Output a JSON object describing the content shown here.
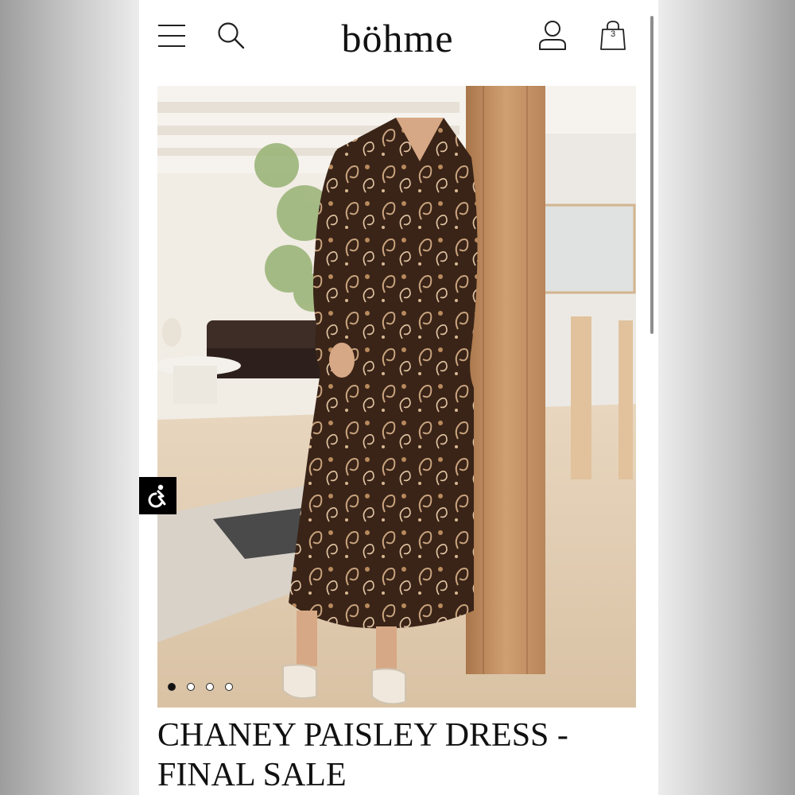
{
  "header": {
    "logo": "böhme",
    "bag_count": "3",
    "icons": [
      "hamburger-menu-icon",
      "search-icon",
      "account-icon",
      "shopping-bag-icon"
    ]
  },
  "product": {
    "title_line1": "CHANEY PAISLEY DRESS -",
    "title_line2": "FINAL SALE"
  },
  "carousel": {
    "total_slides": 4,
    "active_slide": 1
  },
  "accessibility": {
    "icon": "accessibility-icon"
  },
  "colors": {
    "text": "#111111",
    "background": "#ffffff",
    "dress": "#3a2418",
    "paisley": "#c9a47e",
    "wood": "#c39467"
  }
}
